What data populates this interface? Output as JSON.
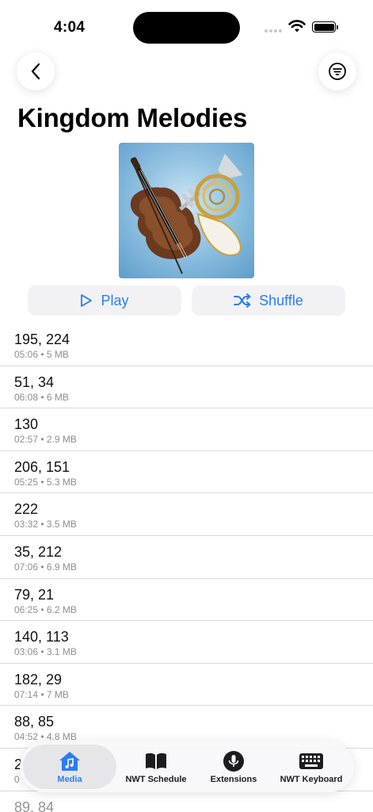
{
  "status_bar": {
    "time": "4:04"
  },
  "nav": {
    "back_icon": "chevron-left-icon",
    "filter_icon": "filter-icon"
  },
  "header": {
    "title": "Kingdom Melodies"
  },
  "artwork": {
    "description_icon": "album-artwork"
  },
  "actions": {
    "play_label": "Play",
    "shuffle_label": "Shuffle",
    "accent": "#2b7cf6"
  },
  "tracks": [
    {
      "title": "195, 224",
      "meta": "05:06 • 5 MB"
    },
    {
      "title": "51, 34",
      "meta": "06:08 • 6 MB"
    },
    {
      "title": "130",
      "meta": "02:57 • 2.9 MB"
    },
    {
      "title": "206, 151",
      "meta": "05:25 • 5.3 MB"
    },
    {
      "title": "222",
      "meta": "03:32 • 3.5 MB"
    },
    {
      "title": "35, 212",
      "meta": "07:06 • 6.9 MB"
    },
    {
      "title": "79, 21",
      "meta": "06:25 • 6.2 MB"
    },
    {
      "title": "140, 113",
      "meta": "03:06 • 3.1 MB"
    },
    {
      "title": "182, 29",
      "meta": "07:14 • 7 MB"
    },
    {
      "title": "88, 85",
      "meta": "04:52 • 4.8 MB"
    },
    {
      "title": "2",
      "meta": "0"
    },
    {
      "title": "89, 84",
      "meta": ""
    }
  ],
  "tab_bar": {
    "tabs": [
      {
        "label": "Media",
        "icon": "music-house-icon",
        "active": true
      },
      {
        "label": "NWT Schedule",
        "icon": "book-icon",
        "active": false
      },
      {
        "label": "Extensions",
        "icon": "microphone-icon",
        "active": false
      },
      {
        "label": "NWT Keyboard",
        "icon": "keyboard-icon",
        "active": false
      }
    ]
  }
}
